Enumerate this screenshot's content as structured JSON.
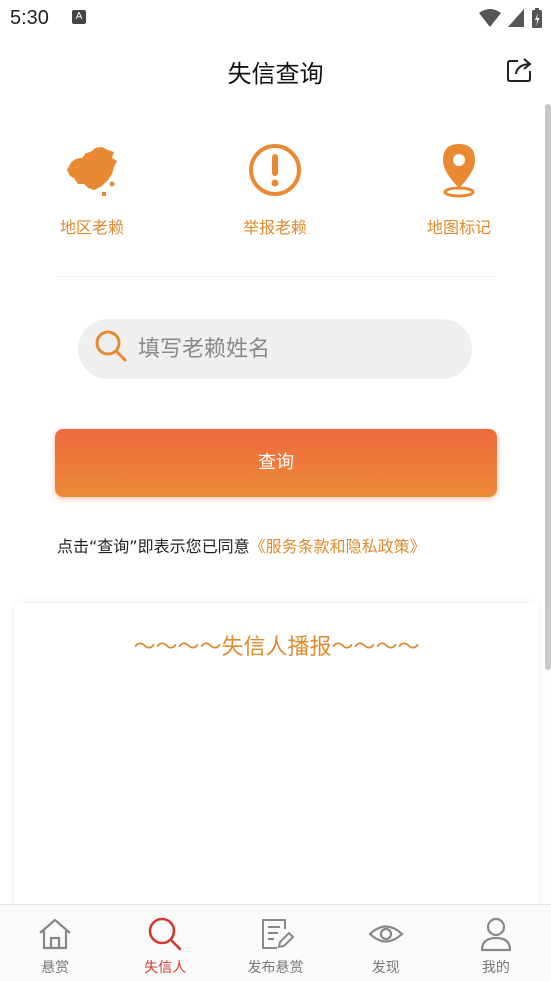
{
  "status_bar": {
    "time": "5:30",
    "notification_letter": "A"
  },
  "header": {
    "title": "失信查询"
  },
  "actions": [
    {
      "label": "地区老赖",
      "icon": "china-map-icon"
    },
    {
      "label": "举报老赖",
      "icon": "exclamation-circle-icon"
    },
    {
      "label": "地图标记",
      "icon": "location-pin-icon"
    }
  ],
  "search": {
    "placeholder": "填写老赖姓名",
    "value": ""
  },
  "query_button": {
    "label": "查询"
  },
  "agreement": {
    "prefix": "点击“查询”即表示您已同意",
    "link": "《服务条款和隐私政策》"
  },
  "broadcast": {
    "title": "～～～～失信人播报～～～～"
  },
  "tabbar": [
    {
      "label": "悬赏",
      "icon": "home-icon",
      "active": false
    },
    {
      "label": "失信人",
      "icon": "search-icon",
      "active": true
    },
    {
      "label": "发布悬赏",
      "icon": "edit-document-icon",
      "active": false
    },
    {
      "label": "发现",
      "icon": "eye-icon",
      "active": false
    },
    {
      "label": "我的",
      "icon": "user-icon",
      "active": false
    }
  ],
  "colors": {
    "accent": "#e08a2e",
    "button_top": "#ec6a3e",
    "button_bottom": "#ee8a34",
    "tab_active": "#d23a2e"
  }
}
